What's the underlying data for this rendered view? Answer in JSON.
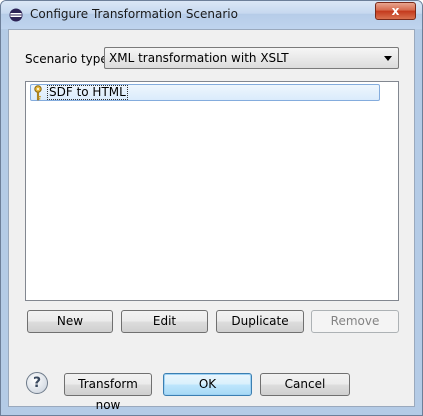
{
  "window": {
    "title": "Configure Transformation Scenario",
    "close_label": "x"
  },
  "scenario_type": {
    "label": "Scenario type:",
    "selected": "XML transformation with XSLT"
  },
  "scenarios": {
    "items": [
      {
        "label": "SDF to HTML",
        "icon": "key-icon",
        "selected": true
      }
    ]
  },
  "list_buttons": {
    "new": "New",
    "edit": "Edit",
    "duplicate": "Duplicate",
    "remove": "Remove"
  },
  "footer": {
    "help": "?",
    "transform_now": "Transform now",
    "ok": "OK",
    "cancel": "Cancel"
  },
  "colors": {
    "selection_border": "#84acdd",
    "default_button_border": "#3c7fb1",
    "close_button": "#c4391c"
  }
}
